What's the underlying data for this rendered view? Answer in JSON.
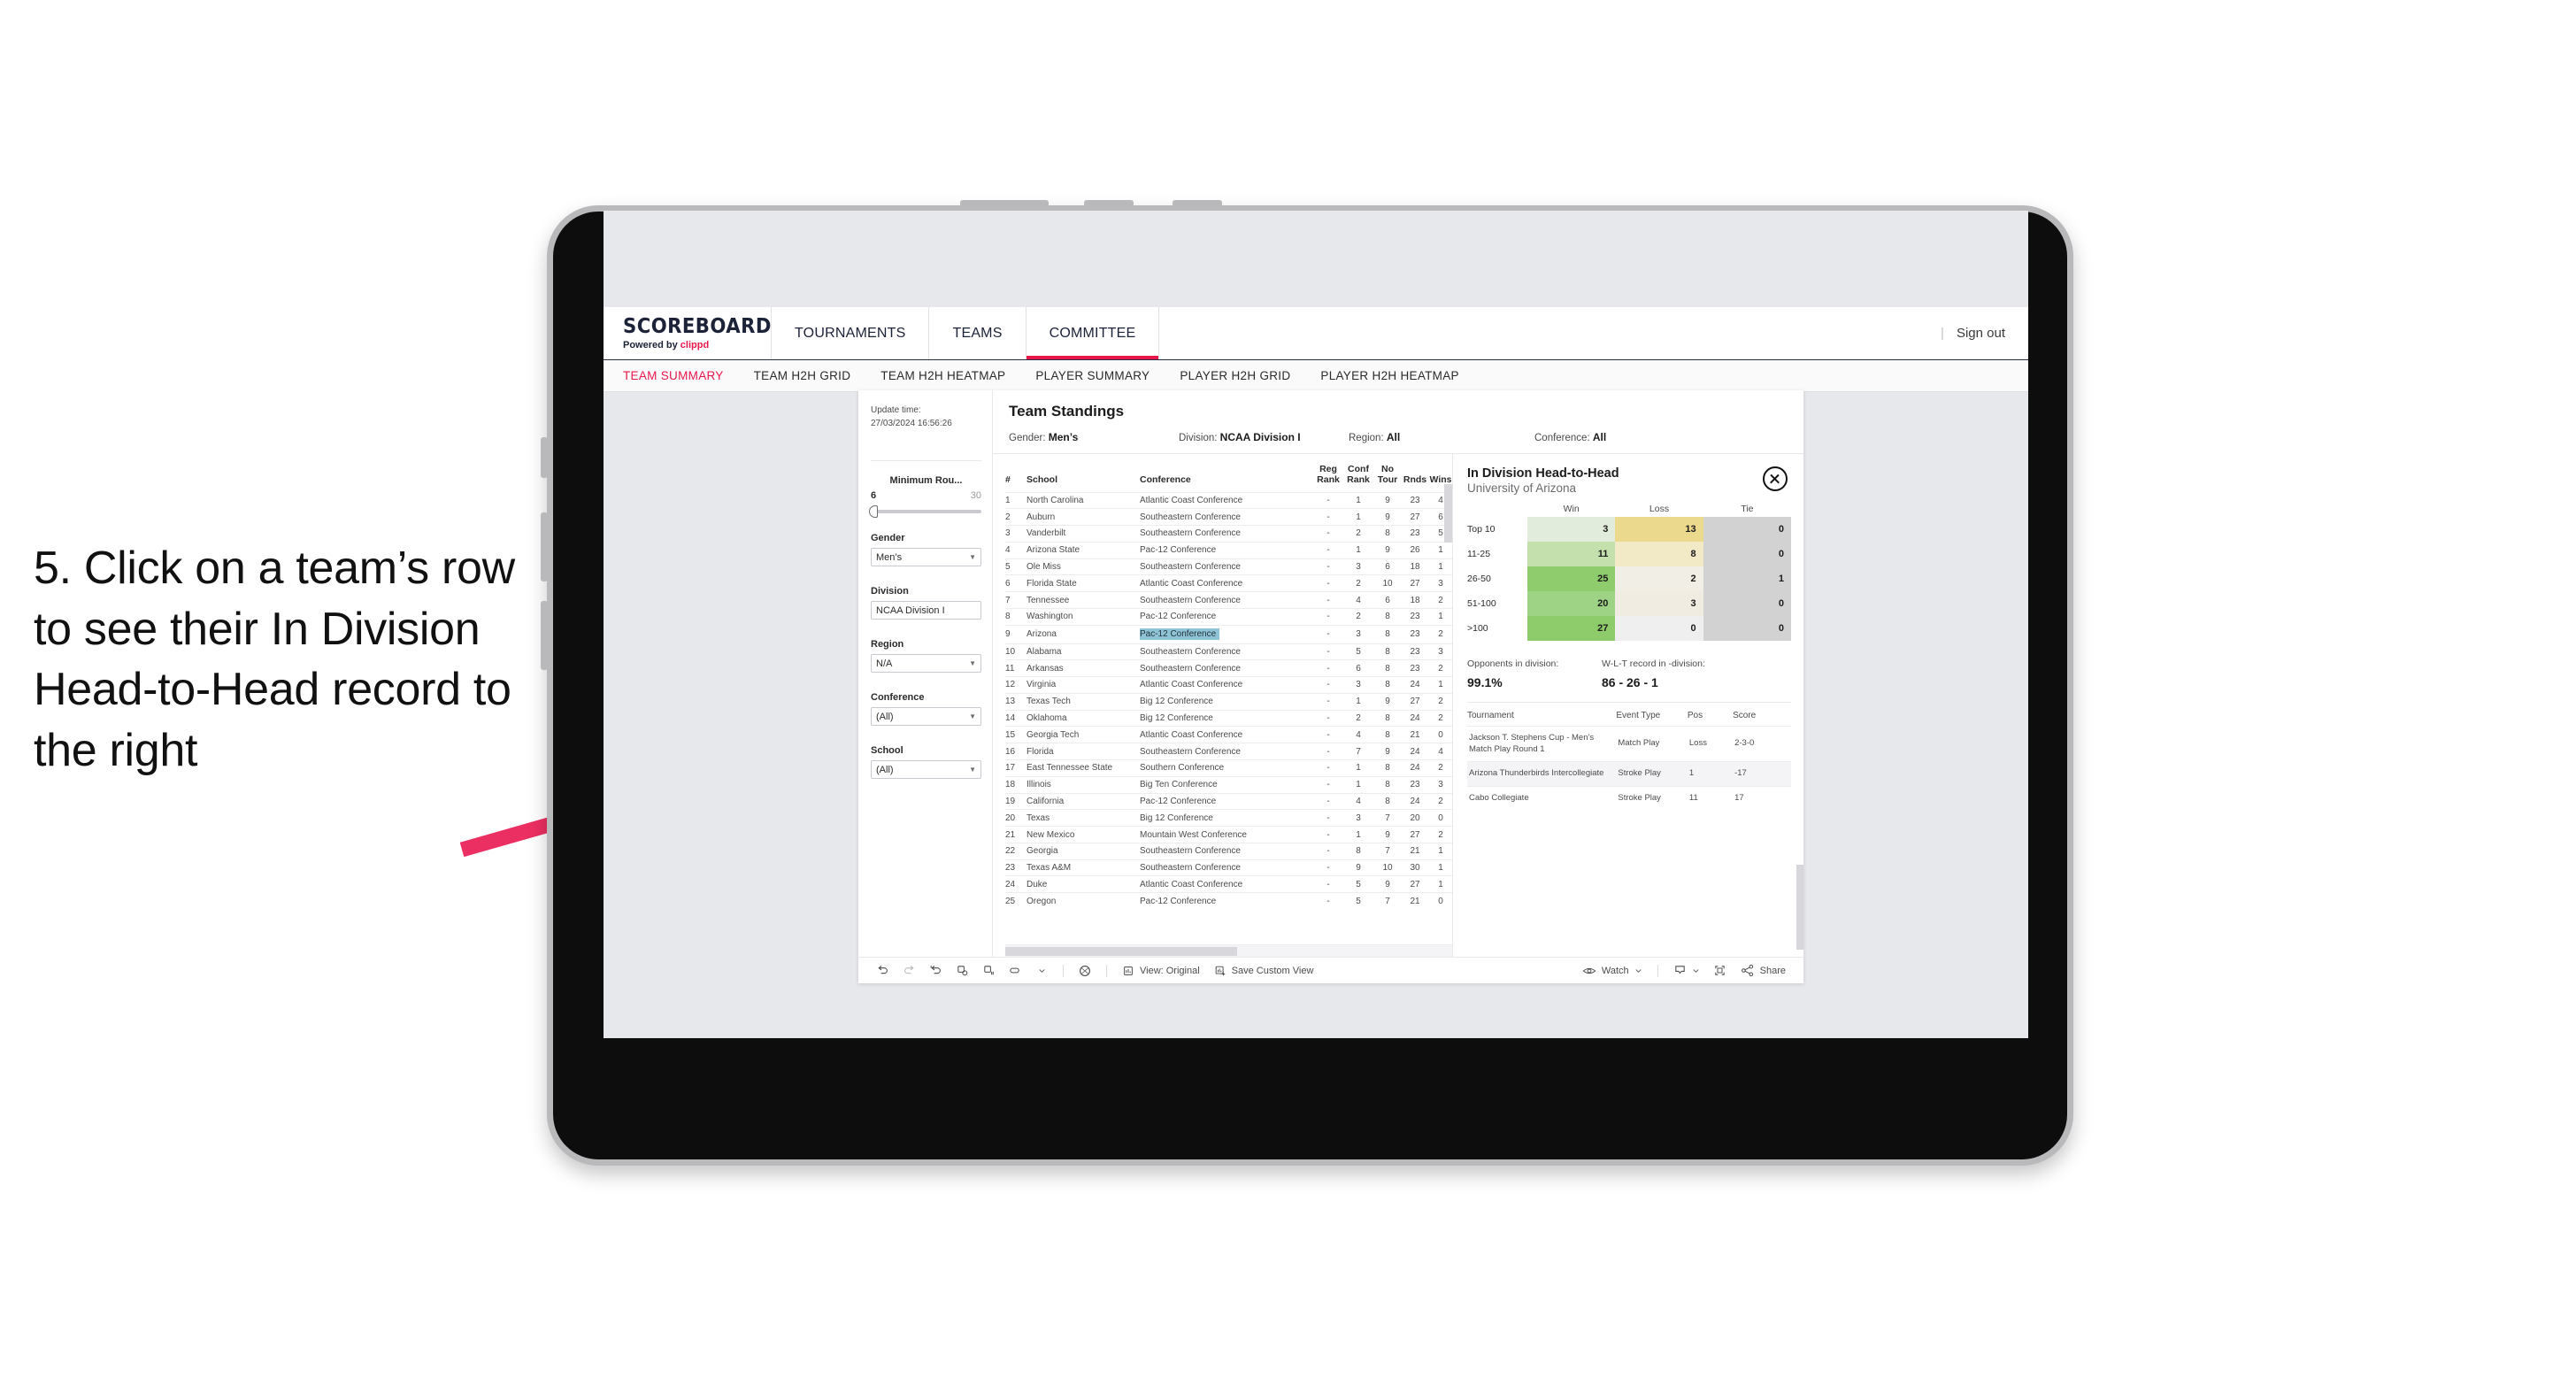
{
  "annotation": {
    "text": "5. Click on a team’s row to see their In Division Head-to-Head record to the right",
    "arrow_color": "#ec2f62"
  },
  "header": {
    "brand_title": "SCOREBOARD",
    "brand_sub_prefix": "Powered by ",
    "brand_sub_name": "clippd",
    "nav": [
      {
        "label": "TOURNAMENTS",
        "active": false
      },
      {
        "label": "TEAMS",
        "active": false
      },
      {
        "label": "COMMITTEE",
        "active": true
      }
    ],
    "divider": "|",
    "sign_out": "Sign out",
    "accent_color": "#e8174b"
  },
  "subnav": [
    {
      "label": "TEAM SUMMARY",
      "active": true
    },
    {
      "label": "TEAM H2H GRID",
      "active": false
    },
    {
      "label": "TEAM H2H HEATMAP",
      "active": false
    },
    {
      "label": "PLAYER SUMMARY",
      "active": false
    },
    {
      "label": "PLAYER H2H GRID",
      "active": false
    },
    {
      "label": "PLAYER H2H HEATMAP",
      "active": false
    }
  ],
  "filters": {
    "update_time_label": "Update time:",
    "update_time_value": "27/03/2024 16:56:26",
    "slider": {
      "title": "Minimum Rou...",
      "min": "6",
      "max": "30"
    },
    "selects": [
      {
        "label": "Gender",
        "value": "Men’s"
      },
      {
        "label": "Division",
        "value": "NCAA Division I"
      },
      {
        "label": "Region",
        "value": "N/A"
      },
      {
        "label": "Conference",
        "value": "(All)"
      },
      {
        "label": "School",
        "value": "(All)"
      }
    ]
  },
  "standings": {
    "title": "Team Standings",
    "summary": {
      "gender_label": "Gender:",
      "gender_value": "Men’s",
      "division_label": "Division:",
      "division_value": "NCAA Division I",
      "region_label": "Region:",
      "region_value": "All",
      "conference_label": "Conference:",
      "conference_value": "All"
    },
    "columns": [
      "#",
      "School",
      "Conference",
      "Reg Rank",
      "Conf Rank",
      "No Tour",
      "Rnds",
      "Wins"
    ],
    "columns_display": {
      "num": "#",
      "school": "School",
      "conference": "Conference",
      "reg_rank_l1": "Reg",
      "reg_rank_l2": "Rank",
      "conf_rank_l1": "Conf",
      "conf_rank_l2": "Rank",
      "no_tour_l1": "No",
      "no_tour_l2": "Tour",
      "rnds": "Rnds",
      "wins": "Wins"
    },
    "selected_row_index": 8,
    "rows": [
      {
        "num": "1",
        "school": "North Carolina",
        "conference": "Atlantic Coast Conference",
        "reg": "-",
        "conf": "1",
        "notour": "9",
        "rnds": "23",
        "wins": "4"
      },
      {
        "num": "2",
        "school": "Auburn",
        "conference": "Southeastern Conference",
        "reg": "-",
        "conf": "1",
        "notour": "9",
        "rnds": "27",
        "wins": "6"
      },
      {
        "num": "3",
        "school": "Vanderbilt",
        "conference": "Southeastern Conference",
        "reg": "-",
        "conf": "2",
        "notour": "8",
        "rnds": "23",
        "wins": "5"
      },
      {
        "num": "4",
        "school": "Arizona State",
        "conference": "Pac-12 Conference",
        "reg": "-",
        "conf": "1",
        "notour": "9",
        "rnds": "26",
        "wins": "1"
      },
      {
        "num": "5",
        "school": "Ole Miss",
        "conference": "Southeastern Conference",
        "reg": "-",
        "conf": "3",
        "notour": "6",
        "rnds": "18",
        "wins": "1"
      },
      {
        "num": "6",
        "school": "Florida State",
        "conference": "Atlantic Coast Conference",
        "reg": "-",
        "conf": "2",
        "notour": "10",
        "rnds": "27",
        "wins": "3"
      },
      {
        "num": "7",
        "school": "Tennessee",
        "conference": "Southeastern Conference",
        "reg": "-",
        "conf": "4",
        "notour": "6",
        "rnds": "18",
        "wins": "2"
      },
      {
        "num": "8",
        "school": "Washington",
        "conference": "Pac-12 Conference",
        "reg": "-",
        "conf": "2",
        "notour": "8",
        "rnds": "23",
        "wins": "1"
      },
      {
        "num": "9",
        "school": "Arizona",
        "conference": "Pac-12 Conference",
        "reg": "-",
        "conf": "3",
        "notour": "8",
        "rnds": "23",
        "wins": "2"
      },
      {
        "num": "10",
        "school": "Alabama",
        "conference": "Southeastern Conference",
        "reg": "-",
        "conf": "5",
        "notour": "8",
        "rnds": "23",
        "wins": "3"
      },
      {
        "num": "11",
        "school": "Arkansas",
        "conference": "Southeastern Conference",
        "reg": "-",
        "conf": "6",
        "notour": "8",
        "rnds": "23",
        "wins": "2"
      },
      {
        "num": "12",
        "school": "Virginia",
        "conference": "Atlantic Coast Conference",
        "reg": "-",
        "conf": "3",
        "notour": "8",
        "rnds": "24",
        "wins": "1"
      },
      {
        "num": "13",
        "school": "Texas Tech",
        "conference": "Big 12 Conference",
        "reg": "-",
        "conf": "1",
        "notour": "9",
        "rnds": "27",
        "wins": "2"
      },
      {
        "num": "14",
        "school": "Oklahoma",
        "conference": "Big 12 Conference",
        "reg": "-",
        "conf": "2",
        "notour": "8",
        "rnds": "24",
        "wins": "2"
      },
      {
        "num": "15",
        "school": "Georgia Tech",
        "conference": "Atlantic Coast Conference",
        "reg": "-",
        "conf": "4",
        "notour": "8",
        "rnds": "21",
        "wins": "0"
      },
      {
        "num": "16",
        "school": "Florida",
        "conference": "Southeastern Conference",
        "reg": "-",
        "conf": "7",
        "notour": "9",
        "rnds": "24",
        "wins": "4"
      },
      {
        "num": "17",
        "school": "East Tennessee State",
        "conference": "Southern Conference",
        "reg": "-",
        "conf": "1",
        "notour": "8",
        "rnds": "24",
        "wins": "2"
      },
      {
        "num": "18",
        "school": "Illinois",
        "conference": "Big Ten Conference",
        "reg": "-",
        "conf": "1",
        "notour": "8",
        "rnds": "23",
        "wins": "3"
      },
      {
        "num": "19",
        "school": "California",
        "conference": "Pac-12 Conference",
        "reg": "-",
        "conf": "4",
        "notour": "8",
        "rnds": "24",
        "wins": "2"
      },
      {
        "num": "20",
        "school": "Texas",
        "conference": "Big 12 Conference",
        "reg": "-",
        "conf": "3",
        "notour": "7",
        "rnds": "20",
        "wins": "0"
      },
      {
        "num": "21",
        "school": "New Mexico",
        "conference": "Mountain West Conference",
        "reg": "-",
        "conf": "1",
        "notour": "9",
        "rnds": "27",
        "wins": "2"
      },
      {
        "num": "22",
        "school": "Georgia",
        "conference": "Southeastern Conference",
        "reg": "-",
        "conf": "8",
        "notour": "7",
        "rnds": "21",
        "wins": "1"
      },
      {
        "num": "23",
        "school": "Texas A&M",
        "conference": "Southeastern Conference",
        "reg": "-",
        "conf": "9",
        "notour": "10",
        "rnds": "30",
        "wins": "1"
      },
      {
        "num": "24",
        "school": "Duke",
        "conference": "Atlantic Coast Conference",
        "reg": "-",
        "conf": "5",
        "notour": "9",
        "rnds": "27",
        "wins": "1"
      },
      {
        "num": "25",
        "school": "Oregon",
        "conference": "Pac-12 Conference",
        "reg": "-",
        "conf": "5",
        "notour": "7",
        "rnds": "21",
        "wins": "0"
      }
    ]
  },
  "h2h": {
    "title": "In Division Head-to-Head",
    "subtitle": "University of Arizona",
    "close_icon": "close-icon",
    "stats": {
      "opponents_label": "Opponents in division:",
      "opponents_value": "99.1%",
      "record_label": "W-L-T record in -division:",
      "record_value": "86 - 26 - 1"
    },
    "tournaments": {
      "columns": [
        "Tournament",
        "Event Type",
        "Pos",
        "Score"
      ],
      "rows": [
        {
          "tournament": "Jackson T. Stephens Cup - Men’s Match Play Round 1",
          "event_type": "Match Play",
          "pos": "Loss",
          "score": "2-3-0"
        },
        {
          "tournament": "Arizona Thunderbirds Intercollegiate",
          "event_type": "Stroke Play",
          "pos": "1",
          "score": "-17"
        },
        {
          "tournament": "Cabo Collegiate",
          "event_type": "Stroke Play",
          "pos": "11",
          "score": "17"
        }
      ]
    }
  },
  "chart_data": {
    "type": "heatmap",
    "title": "In Division Head-to-Head",
    "subtitle": "University of Arizona",
    "xlabel": "",
    "ylabel": "",
    "columns": [
      "Win",
      "Loss",
      "Tie"
    ],
    "rows": [
      "Top 10",
      "11-25",
      "26-50",
      "51-100",
      ">100"
    ],
    "values": [
      [
        3,
        13,
        0
      ],
      [
        11,
        8,
        0
      ],
      [
        25,
        2,
        1
      ],
      [
        20,
        3,
        0
      ],
      [
        27,
        0,
        0
      ]
    ],
    "cell_colors": [
      [
        "#e2ecdc",
        "#ebd98d",
        "#d2d2d2"
      ],
      [
        "#c4e0ad",
        "#f2e9c6",
        "#d2d2d2"
      ],
      [
        "#8fcc6d",
        "#f1efe5",
        "#d2d2d2"
      ],
      [
        "#9ed284",
        "#f0ece1",
        "#d2d2d2"
      ],
      [
        "#8ecb6b",
        "#efefef",
        "#d2d2d2"
      ]
    ],
    "legend": "none",
    "grid": false
  },
  "toolbar": {
    "view_label": "View: Original",
    "save_label": "Save Custom View",
    "watch_label": "Watch",
    "share_label": "Share",
    "icons": [
      "undo-icon",
      "redo-icon",
      "revert-icon",
      "refresh-data-icon",
      "pause-updates-icon",
      "alerts-icon",
      "dropdown-caret-icon",
      "help-icon",
      "view-original-icon",
      "save-custom-view-icon",
      "watch-eye-icon",
      "download-icon",
      "fullscreen-icon",
      "share-icon"
    ]
  }
}
